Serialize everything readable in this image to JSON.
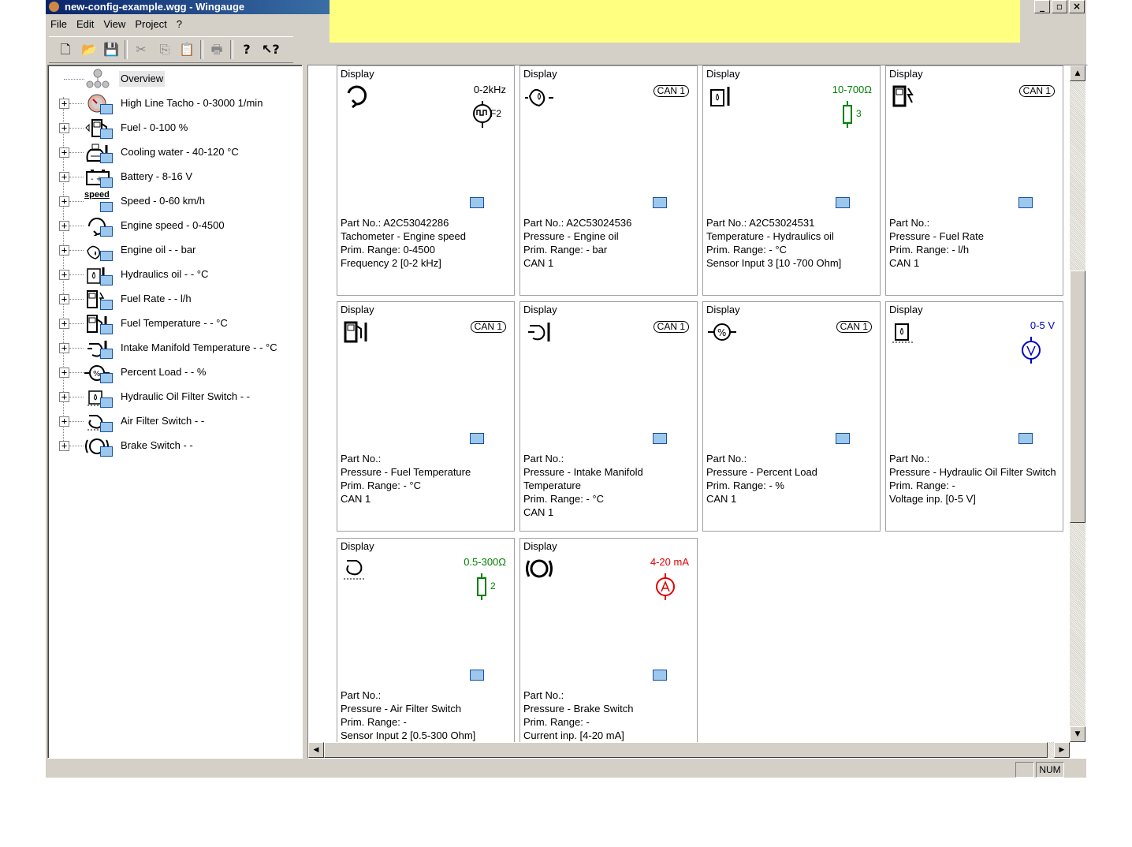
{
  "window": {
    "title": "new-config-example.wgg - Wingauge",
    "buttons": [
      "_",
      "▫",
      "×"
    ]
  },
  "menu": [
    "File",
    "Edit",
    "View",
    "Project",
    "?"
  ],
  "toolbar": {
    "icons": [
      "new-file-icon",
      "open-folder-icon",
      "save-icon",
      "cut-icon",
      "copy-icon",
      "paste-icon",
      "print-icon",
      "help-icon",
      "context-help-icon"
    ]
  },
  "tree": {
    "root": "Overview",
    "items": [
      {
        "label": "High Line Tacho - 0-3000 1/min",
        "icon": "tacho-gauge-icon"
      },
      {
        "label": "Fuel - 0-100 %",
        "icon": "fuel-pump-icon"
      },
      {
        "label": "Cooling water - 40-120 °C",
        "icon": "cooling-water-icon"
      },
      {
        "label": "Battery - 8-16 V",
        "icon": "battery-icon"
      },
      {
        "label": "Speed - 0-60 km/h",
        "icon": "speed-icon"
      },
      {
        "label": "Engine speed - 0-4500",
        "icon": "engine-speed-icon"
      },
      {
        "label": "Engine oil - - bar",
        "icon": "engine-oil-icon"
      },
      {
        "label": "Hydraulics oil - - °C",
        "icon": "hydraulics-oil-icon"
      },
      {
        "label": "Fuel Rate - - l/h",
        "icon": "fuel-rate-icon"
      },
      {
        "label": "Fuel Temperature - - °C",
        "icon": "fuel-temperature-icon"
      },
      {
        "label": "Intake Manifold Temperature - - °C",
        "icon": "intake-manifold-icon"
      },
      {
        "label": "Percent Load - - %",
        "icon": "percent-load-icon"
      },
      {
        "label": "Hydraulic Oil Filter Switch - -",
        "icon": "hydraulic-filter-icon"
      },
      {
        "label": "Air Filter Switch - -",
        "icon": "air-filter-icon"
      },
      {
        "label": "Brake Switch - -",
        "icon": "brake-icon"
      }
    ],
    "speed_icon_text": "speed"
  },
  "cards": [
    {
      "display": "Display",
      "range": "0-2kHz",
      "range_color": "#000000",
      "sensor": "frequency",
      "sensor_tag": "F2",
      "badge": "",
      "icon": "tacho-symbol-icon",
      "lines": [
        "Part No.: A2C53042286",
        "Tachometer - Engine speed",
        "Prim. Range: 0-4500",
        "Frequency 2 [0-2 kHz]"
      ]
    },
    {
      "display": "Display",
      "range": "",
      "badge": "CAN 1",
      "icon": "oil-pressure-symbol-icon",
      "lines": [
        "Part No.: A2C53024536",
        "Pressure - Engine oil",
        "Prim. Range: - bar",
        "CAN 1"
      ]
    },
    {
      "display": "Display",
      "range": "10-700Ω",
      "range_color": "#008000",
      "sensor": "resistor",
      "sensor_tag": "3",
      "badge": "",
      "icon": "hydraulic-temp-symbol-icon",
      "lines": [
        "Part No.: A2C53024531",
        "Temperature - Hydraulics oil",
        "Prim. Range: - °C",
        "Sensor Input 3 [10 -700 Ohm]"
      ]
    },
    {
      "display": "Display",
      "range": "",
      "badge": "CAN 1",
      "icon": "fuel-rate-symbol-icon",
      "lines": [
        "Part No.:",
        "Pressure - Fuel Rate",
        "Prim. Range: - l/h",
        "CAN 1"
      ]
    },
    {
      "display": "Display",
      "range": "",
      "badge": "CAN 1",
      "icon": "fuel-temp-symbol-icon",
      "lines": [
        "Part No.:",
        "Pressure - Fuel Temperature",
        "Prim. Range: - °C",
        "CAN 1"
      ]
    },
    {
      "display": "Display",
      "range": "",
      "badge": "CAN 1",
      "icon": "intake-temp-symbol-icon",
      "lines": [
        "Part No.:",
        "Pressure - Intake Manifold",
        "Temperature",
        "Prim. Range: - °C",
        "CAN 1"
      ]
    },
    {
      "display": "Display",
      "range": "",
      "badge": "CAN 1",
      "icon": "percent-load-symbol-icon",
      "lines": [
        "Part No.:",
        "Pressure - Percent Load",
        "Prim. Range: - %",
        "CAN 1"
      ]
    },
    {
      "display": "Display",
      "range": "0-5 V",
      "range_color": "#0000c0",
      "sensor": "voltage",
      "sensor_tag": "",
      "badge": "",
      "icon": "filter-switch-symbol-icon",
      "lines": [
        "Part No.:",
        "Pressure - Hydraulic Oil Filter Switch",
        "Prim. Range: -",
        "Voltage inp. [0-5 V]"
      ]
    },
    {
      "display": "Display",
      "range": "0.5-300Ω",
      "range_color": "#008000",
      "sensor": "resistor",
      "sensor_tag": "2",
      "badge": "",
      "icon": "air-filter-symbol-icon",
      "lines": [
        "Part No.:",
        "Pressure - Air Filter Switch",
        "Prim. Range: -",
        "Sensor Input 2 [0.5-300 Ohm]"
      ]
    },
    {
      "display": "Display",
      "range": "4-20 mA",
      "range_color": "#e00000",
      "sensor": "current",
      "sensor_tag": "",
      "badge": "",
      "icon": "brake-symbol-icon",
      "lines": [
        "Part No.:",
        "Pressure - Brake Switch",
        "Prim. Range: -",
        "Current inp. [4-20 mA]"
      ]
    }
  ],
  "status": {
    "num": "NUM"
  }
}
